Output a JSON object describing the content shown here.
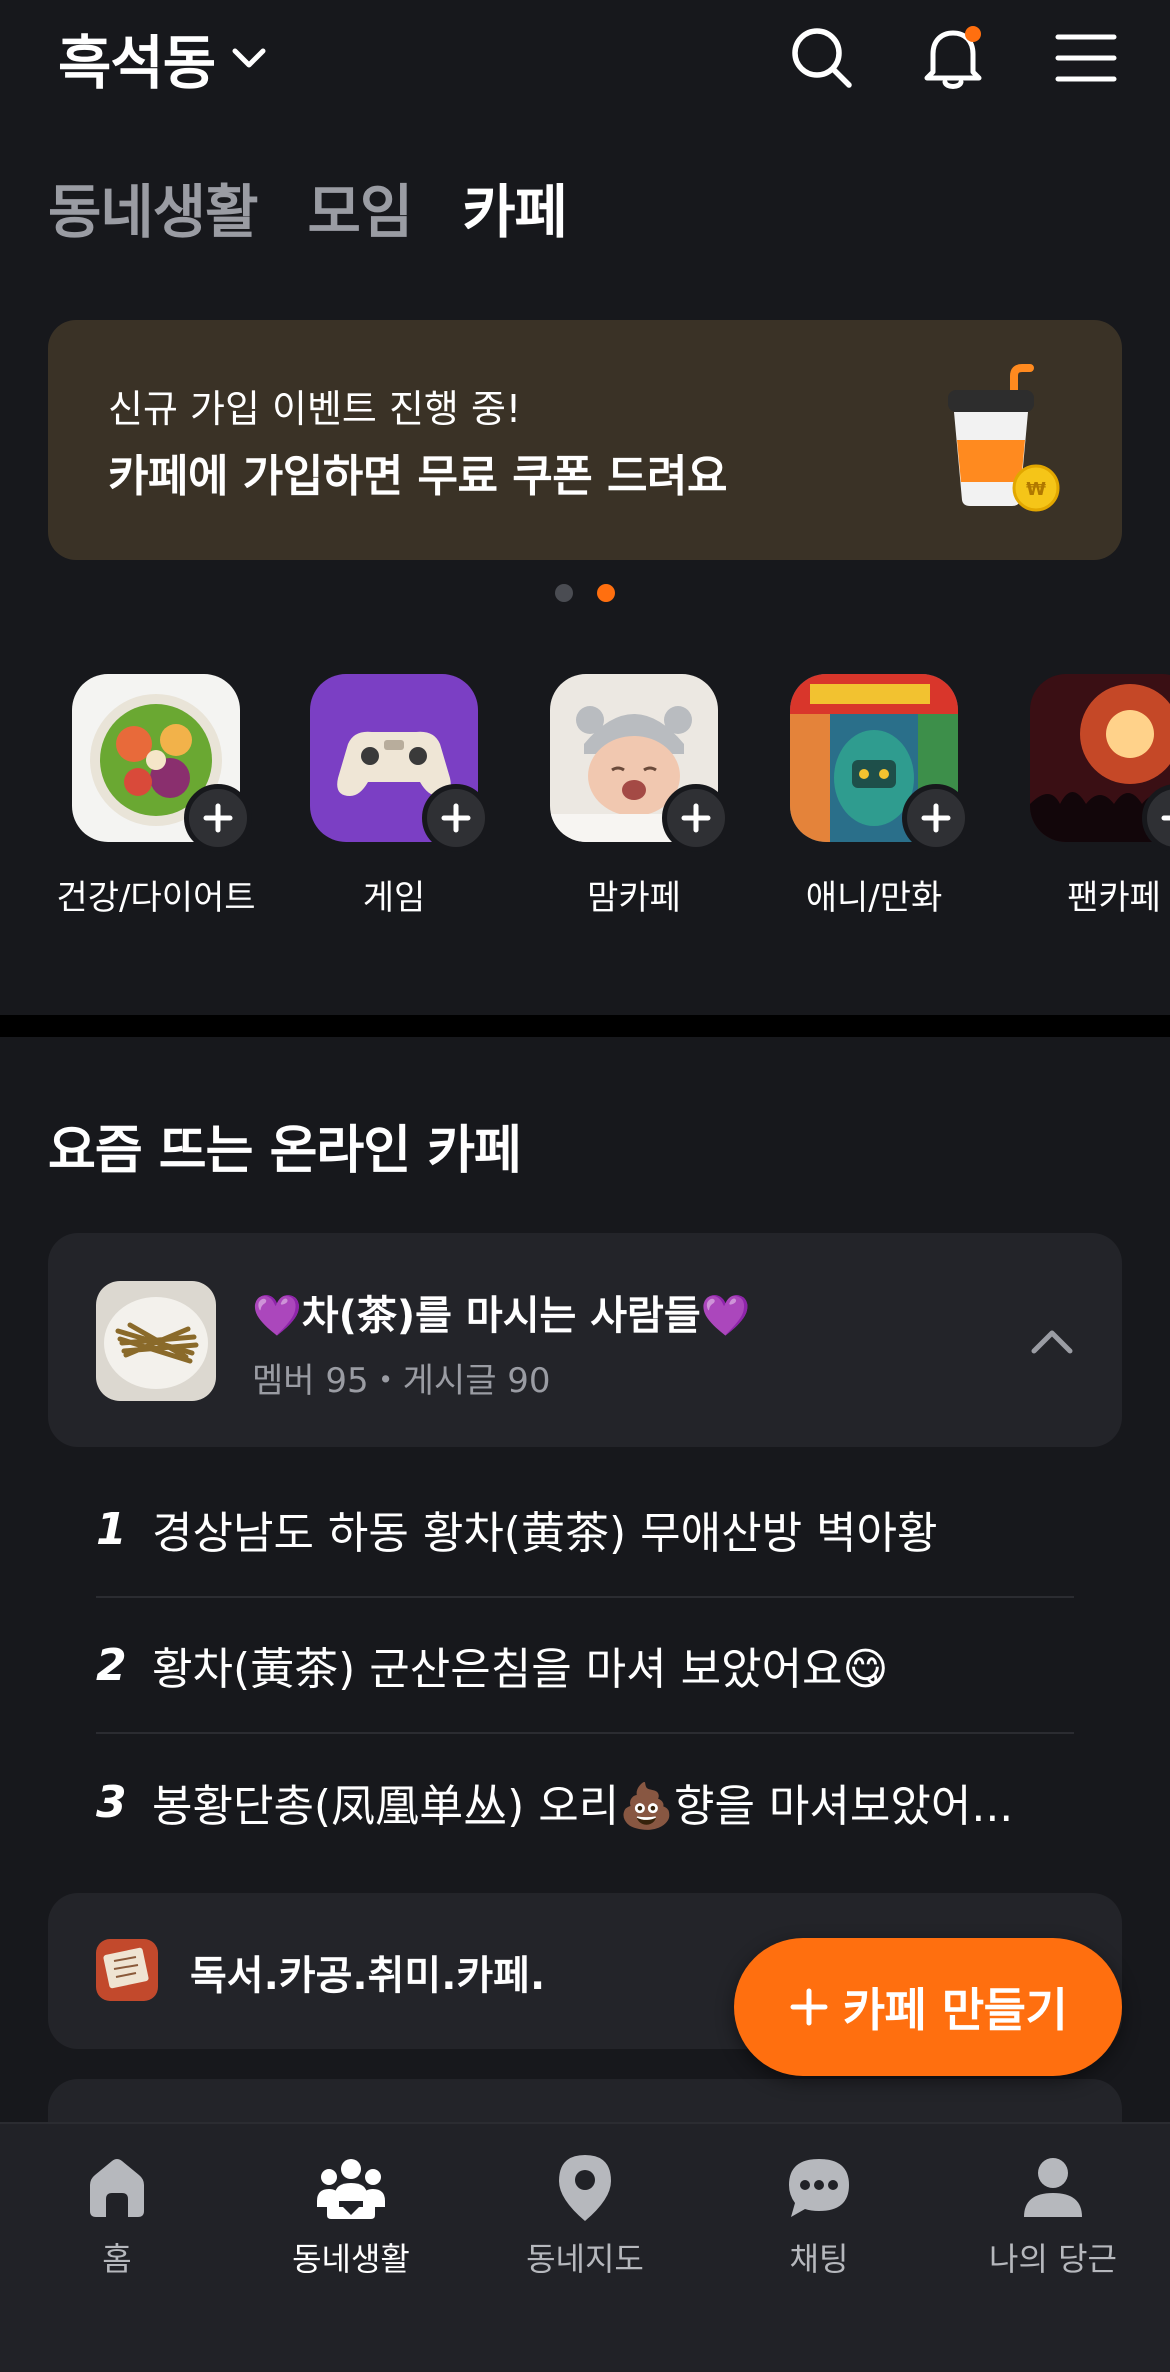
{
  "header": {
    "location": "흑석동",
    "icons": [
      "search-icon",
      "bell-icon",
      "menu-icon"
    ],
    "has_notification": true
  },
  "tabs": [
    {
      "label": "동네생활",
      "active": false
    },
    {
      "label": "모임",
      "active": false
    },
    {
      "label": "카페",
      "active": true
    }
  ],
  "banner": {
    "subtitle": "신규 가입 이벤트 진행 중!",
    "title": "카페에 가입하면 무료 쿠폰 드려요",
    "page_current": 2,
    "page_total": 2
  },
  "categories": [
    {
      "label": "건강/다이어트",
      "icon": "salad-bowl-image"
    },
    {
      "label": "게임",
      "icon": "gamepad-image"
    },
    {
      "label": "맘카페",
      "icon": "baby-image"
    },
    {
      "label": "애니/만화",
      "icon": "comic-image"
    },
    {
      "label": "팬카페",
      "icon": "concert-image"
    }
  ],
  "trending": {
    "title": "요즘 뜨는 온라인 카페",
    "cafe": {
      "name": "💜차(茶)를 마시는 사람들💜",
      "meta": "멤버 95・게시글 90",
      "posts": [
        {
          "num": "1",
          "title": "경상남도 하동 황차(黄茶) 무애산방 벽아황"
        },
        {
          "num": "2",
          "title": "황차(黃茶) 군산은침을 마셔 보았어요😋"
        },
        {
          "num": "3",
          "title": "봉황단총(凤凰单丛) 오리💩향을 마셔보았어..."
        }
      ]
    },
    "cafe2": {
      "name": "독서.카공.취미.카페."
    }
  },
  "fab": {
    "label": "카페 만들기"
  },
  "bottom_nav": [
    {
      "label": "홈",
      "icon": "home-icon",
      "active": false
    },
    {
      "label": "동네생활",
      "icon": "community-icon",
      "active": true
    },
    {
      "label": "동네지도",
      "icon": "map-pin-icon",
      "active": false
    },
    {
      "label": "채팅",
      "icon": "chat-icon",
      "active": false
    },
    {
      "label": "나의 당근",
      "icon": "profile-icon",
      "active": false
    }
  ],
  "colors": {
    "accent": "#ff6f0f",
    "background": "#17181c",
    "card": "#232429",
    "banner": "#3a3226"
  }
}
